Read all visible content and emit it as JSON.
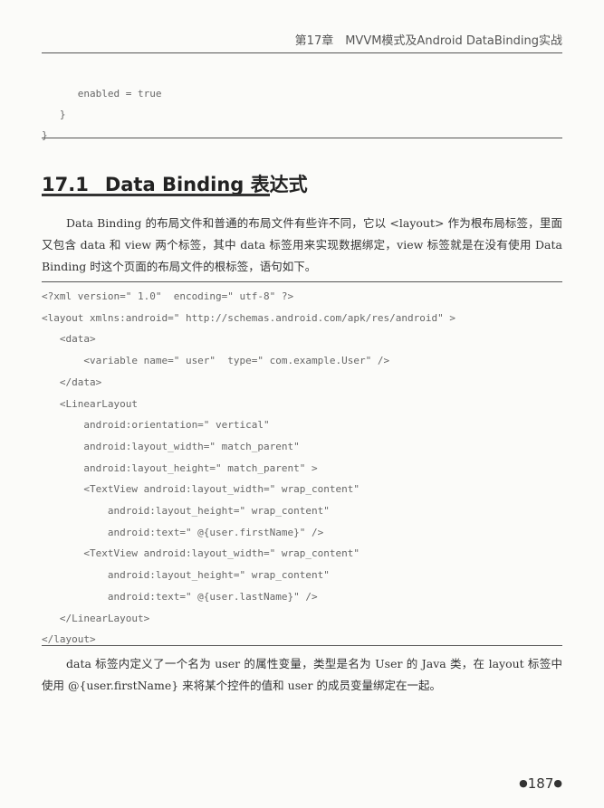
{
  "header": {
    "running_head": "第17章　MVVM模式及Android DataBinding实战"
  },
  "code_top": {
    "lines": [
      "      enabled = true",
      "   }",
      "}"
    ]
  },
  "section": {
    "number": "17.1",
    "title": "Data Binding 表达式"
  },
  "paragraph1": "Data Binding 的布局文件和普通的布局文件有些许不同，它以 <layout> 作为根布局标签，里面又包含 data 和 view 两个标签，其中 data 标签用来实现数据绑定，view 标签就是在没有使用 Data Binding 时这个页面的布局文件的根标签，语句如下。",
  "code_main": {
    "lines": [
      "<?xml version=\" 1.0\"  encoding=\" utf-8\" ?>",
      "<layout xmlns:android=\" http://schemas.android.com/apk/res/android\" >",
      "   <data>",
      "       <variable name=\" user\"  type=\" com.example.User\" />",
      "   </data>",
      "   <LinearLayout",
      "       android:orientation=\" vertical\"",
      "       android:layout_width=\" match_parent\"",
      "       android:layout_height=\" match_parent\" >",
      "       <TextView android:layout_width=\" wrap_content\"",
      "           android:layout_height=\" wrap_content\"",
      "           android:text=\" @{user.firstName}\" />",
      "       <TextView android:layout_width=\" wrap_content\"",
      "           android:layout_height=\" wrap_content\"",
      "           android:text=\" @{user.lastName}\" />",
      "   </LinearLayout>",
      "</layout>"
    ]
  },
  "paragraph2": "data 标签内定义了一个名为 user 的属性变量，类型是名为 User 的 Java 类，在 layout 标签中使用 @{user.firstName} 来将某个控件的值和 user 的成员变量绑定在一起。",
  "footer": {
    "page_number": "187"
  }
}
